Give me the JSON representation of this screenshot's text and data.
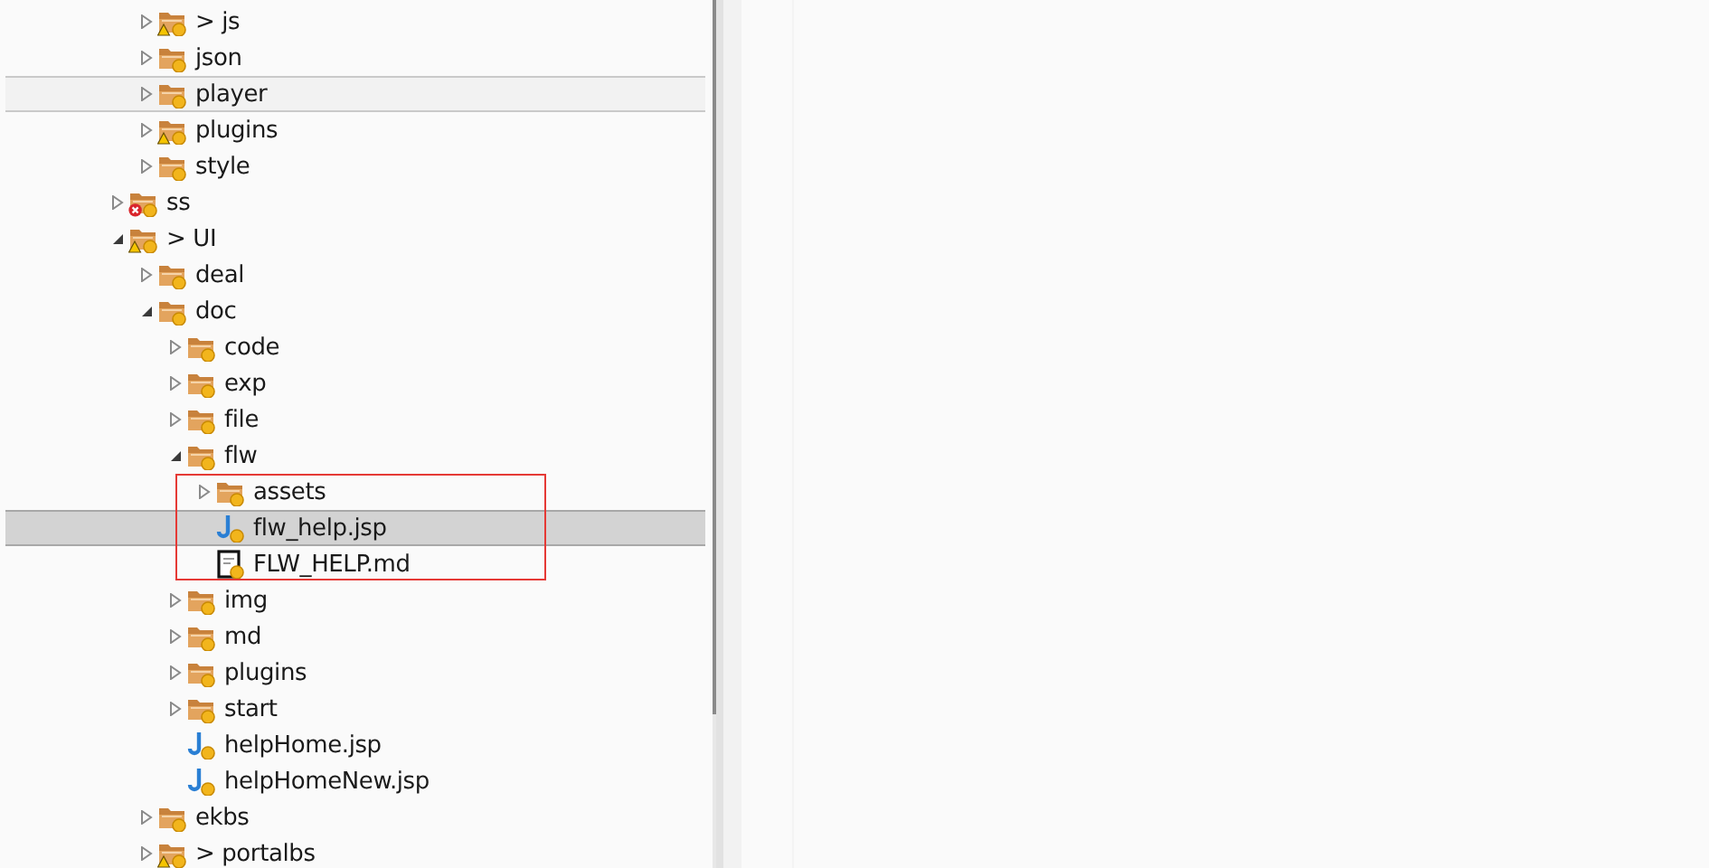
{
  "tree": {
    "items": [
      {
        "children": [
          {
            "label": "> js",
            "kind": "folder",
            "warning": true,
            "error": false,
            "expanded": false,
            "selected": false,
            "hovered": false,
            "boxed": false
          },
          {
            "label": "json",
            "kind": "folder",
            "warning": false,
            "error": false,
            "expanded": false,
            "selected": false,
            "hovered": false,
            "boxed": false
          },
          {
            "label": "player",
            "kind": "folder",
            "warning": false,
            "error": false,
            "expanded": false,
            "selected": false,
            "hovered": true,
            "boxed": false
          },
          {
            "label": "plugins",
            "kind": "folder",
            "warning": true,
            "error": false,
            "expanded": false,
            "selected": false,
            "hovered": false,
            "boxed": false
          },
          {
            "label": "style",
            "kind": "folder",
            "warning": false,
            "error": false,
            "expanded": false,
            "selected": false,
            "hovered": false,
            "boxed": false
          }
        ]
      },
      {
        "label": "ss",
        "kind": "folder",
        "warning": false,
        "error": true,
        "expanded": false,
        "selected": false,
        "hovered": false,
        "boxed": false
      },
      {
        "label": "> UI",
        "kind": "folder",
        "warning": true,
        "error": false,
        "expanded": true,
        "selected": false,
        "hovered": false,
        "boxed": false,
        "children": [
          {
            "label": "deal",
            "kind": "folder",
            "warning": false,
            "error": false,
            "expanded": false,
            "selected": false,
            "hovered": false,
            "boxed": false
          },
          {
            "label": "doc",
            "kind": "folder",
            "warning": false,
            "error": false,
            "expanded": true,
            "selected": false,
            "hovered": false,
            "boxed": false,
            "children": [
              {
                "label": "code",
                "kind": "folder",
                "warning": false,
                "error": false,
                "expanded": false,
                "selected": false,
                "hovered": false,
                "boxed": false
              },
              {
                "label": "exp",
                "kind": "folder",
                "warning": false,
                "error": false,
                "expanded": false,
                "selected": false,
                "hovered": false,
                "boxed": false
              },
              {
                "label": "file",
                "kind": "folder",
                "warning": false,
                "error": false,
                "expanded": false,
                "selected": false,
                "hovered": false,
                "boxed": false
              },
              {
                "label": "flw",
                "kind": "folder",
                "warning": false,
                "error": false,
                "expanded": true,
                "selected": false,
                "hovered": false,
                "boxed": false,
                "children": [
                  {
                    "label": "assets",
                    "kind": "folder",
                    "warning": false,
                    "error": false,
                    "expanded": false,
                    "selected": false,
                    "hovered": false,
                    "boxed": true
                  },
                  {
                    "label": "flw_help.jsp",
                    "kind": "jsp",
                    "warning": false,
                    "error": false,
                    "selected": true,
                    "hovered": false,
                    "boxed": true
                  },
                  {
                    "label": "FLW_HELP.md",
                    "kind": "md",
                    "warning": false,
                    "error": false,
                    "selected": false,
                    "hovered": false,
                    "boxed": true
                  }
                ]
              },
              {
                "label": "img",
                "kind": "folder",
                "warning": false,
                "error": false,
                "expanded": false,
                "selected": false,
                "hovered": false,
                "boxed": false
              },
              {
                "label": "md",
                "kind": "folder",
                "warning": false,
                "error": false,
                "expanded": false,
                "selected": false,
                "hovered": false,
                "boxed": false
              },
              {
                "label": "plugins",
                "kind": "folder",
                "warning": false,
                "error": false,
                "expanded": false,
                "selected": false,
                "hovered": false,
                "boxed": false
              },
              {
                "label": "start",
                "kind": "folder",
                "warning": false,
                "error": false,
                "expanded": false,
                "selected": false,
                "hovered": false,
                "boxed": false
              },
              {
                "label": "helpHome.jsp",
                "kind": "jsp",
                "warning": false,
                "error": false,
                "selected": false,
                "hovered": false,
                "boxed": false
              },
              {
                "label": "helpHomeNew.jsp",
                "kind": "jsp",
                "warning": false,
                "error": false,
                "selected": false,
                "hovered": false,
                "boxed": false
              }
            ]
          },
          {
            "label": "ekbs",
            "kind": "folder",
            "warning": false,
            "error": false,
            "expanded": false,
            "selected": false,
            "hovered": false,
            "boxed": false
          },
          {
            "label": "> portalbs",
            "kind": "folder",
            "warning": true,
            "error": false,
            "expanded": false,
            "selected": false,
            "hovered": false,
            "boxed": false
          }
        ]
      }
    ]
  },
  "highlight_box": {
    "color": "#e53935"
  }
}
